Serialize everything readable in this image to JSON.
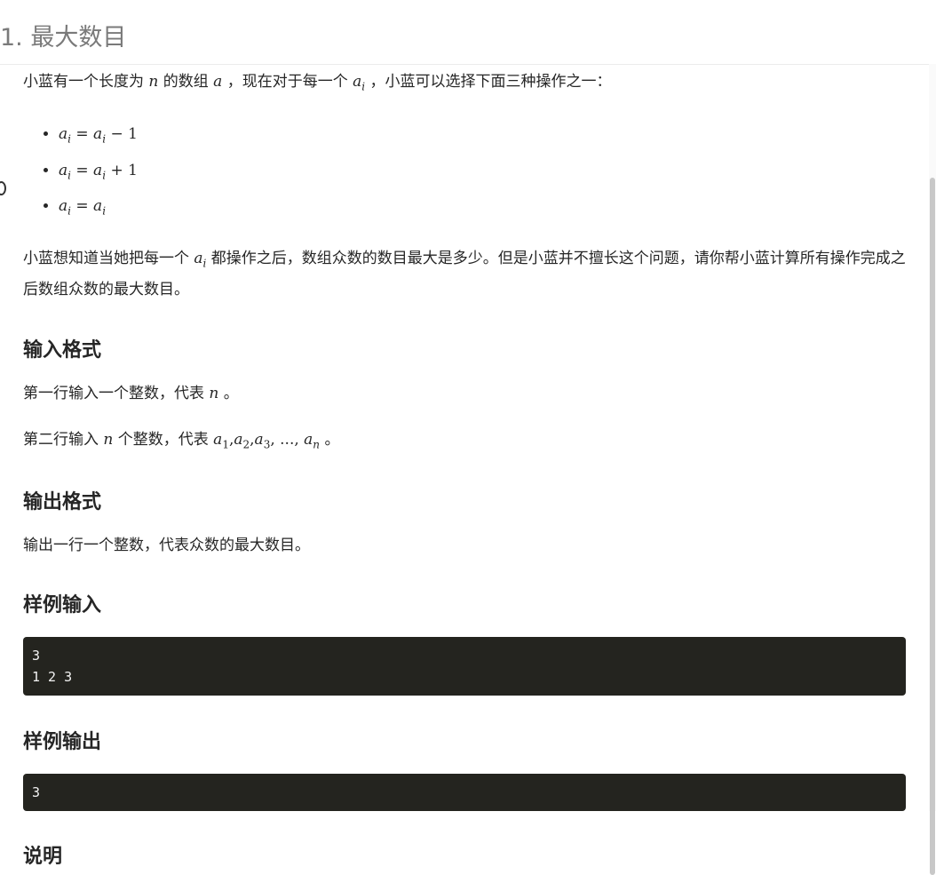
{
  "problem": {
    "title": "1. 最大数目"
  },
  "statement": {
    "intro": {
      "t1": "小蓝有一个长度为",
      "n": "n",
      "t2": "的数组",
      "a": "a",
      "t3": "，现在对于每一个",
      "ai": "a",
      "i": "i",
      "t4": "，小蓝可以选择下面三种操作之一："
    },
    "ops": [
      {
        "lhs": "a",
        "li": "i",
        "eq": "=",
        "rhs": "a",
        "ri": "i",
        "op": "−",
        "num": "1"
      },
      {
        "lhs": "a",
        "li": "i",
        "eq": "=",
        "rhs": "a",
        "ri": "i",
        "op": "+",
        "num": "1"
      },
      {
        "lhs": "a",
        "li": "i",
        "eq": "=",
        "rhs": "a",
        "ri": "i"
      }
    ],
    "desc": {
      "t1": "小蓝想知道当她把每一个",
      "ai": "a",
      "i": "i",
      "t2": "都操作之后，数组众数的数目最大是多少。但是小蓝并不擅长这个问题，请你帮小蓝计算所有操作完成之后数组众数的最大数目。"
    }
  },
  "input_section": {
    "heading": "输入格式",
    "line1": {
      "t1": "第一行输入一个整数，代表",
      "n": "n",
      "t2": "。"
    },
    "line2": {
      "t1": "第二行输入",
      "n": "n",
      "t2": "个整数，代表",
      "seq": [
        "a",
        "1",
        ",",
        "a",
        "2",
        ",",
        "a",
        "3",
        ", ..., ",
        "a",
        "n"
      ],
      "t3": "。"
    }
  },
  "output_section": {
    "heading": "输出格式",
    "text": "输出一行一个整数，代表众数的最大数目。"
  },
  "sample_input": {
    "heading": "样例输入",
    "code": "3\n1 2 3"
  },
  "sample_output": {
    "heading": "样例输出",
    "code": "3"
  },
  "explanation": {
    "heading": "说明"
  }
}
